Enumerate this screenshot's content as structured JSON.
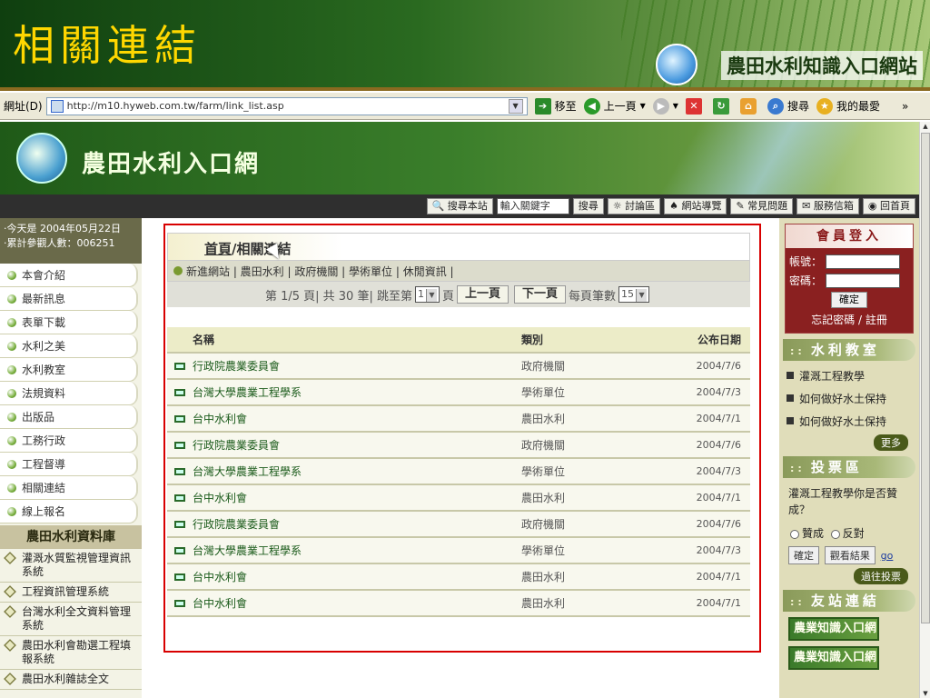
{
  "slide": {
    "title": "相關連結",
    "portal_name": "農田水利知識入口網站"
  },
  "browser": {
    "address_label": "網址(D)",
    "url": "http://m10.hyweb.com.tw/farm/link_list.asp",
    "go_label": "移至",
    "back_label": "上一頁",
    "search_label": "搜尋",
    "favorites_label": "我的最愛",
    "overflow": "»"
  },
  "site": {
    "name": "農田水利入口網"
  },
  "nav": {
    "search_site": "搜尋本站",
    "keyword_placeholder": "輸入關鍵字",
    "search_btn": "搜尋",
    "items": [
      "討論區",
      "網站導覽",
      "常見問題",
      "服務信箱",
      "回首頁"
    ]
  },
  "left": {
    "today": "·今天是 2004年05月22日",
    "visits": "·累計參觀人數：006251",
    "menu": [
      "本會介紹",
      "最新訊息",
      "表單下載",
      "水利之美",
      "水利教室",
      "法規資料",
      "出版品",
      "工務行政",
      "工程督導",
      "相關連結",
      "線上報名"
    ],
    "db_title": "農田水利資料庫",
    "db_items": [
      "灌溉水質監視管理資訊系統",
      "工程資訊管理系統",
      "台灣水利全文資料管理系統",
      "農田水利會勘選工程填報系統",
      "農田水利雜誌全文"
    ]
  },
  "main": {
    "crumb_home": "首頁",
    "crumb_sep": "/",
    "crumb_current": "相關連結",
    "categories": "新進網站 | 農田水利 | 政府機關 | 學術單位 | 休閒資訊 |",
    "pager": {
      "page_text": "第 1/5 頁| 共 30 筆| 跳至第",
      "page_value": "1",
      "page_unit": "頁",
      "prev": "上一頁",
      "next": "下一頁",
      "per_page_label": "每頁筆數",
      "per_page_value": "15"
    },
    "table": {
      "headers": [
        "名稱",
        "類別",
        "公布日期"
      ],
      "rows": [
        {
          "name": "行政院農業委員會",
          "cat": "政府機關",
          "date": "2004/7/6"
        },
        {
          "name": "台灣大學農業工程學系",
          "cat": "學術單位",
          "date": "2004/7/3"
        },
        {
          "name": "台中水利會",
          "cat": "農田水利",
          "date": "2004/7/1"
        },
        {
          "name": "行政院農業委員會",
          "cat": "政府機關",
          "date": "2004/7/6"
        },
        {
          "name": "台灣大學農業工程學系",
          "cat": "學術單位",
          "date": "2004/7/3"
        },
        {
          "name": "台中水利會",
          "cat": "農田水利",
          "date": "2004/7/1"
        },
        {
          "name": "行政院農業委員會",
          "cat": "政府機關",
          "date": "2004/7/6"
        },
        {
          "name": "台灣大學農業工程學系",
          "cat": "學術單位",
          "date": "2004/7/3"
        },
        {
          "name": "台中水利會",
          "cat": "農田水利",
          "date": "2004/7/1"
        },
        {
          "name": "台中水利會",
          "cat": "農田水利",
          "date": "2004/7/1"
        }
      ]
    }
  },
  "right": {
    "login": {
      "title": "會員登入",
      "account": "帳號：",
      "password": "密碼：",
      "submit": "確定",
      "forgot": "忘記密碼 / 註冊"
    },
    "classroom": {
      "title": "水利教室",
      "items": [
        "灌溉工程教學",
        "如何做好水土保持",
        "如何做好水土保持"
      ],
      "more": "更多"
    },
    "vote": {
      "title": "投票區",
      "question": "灌溉工程教學你是否贊成？",
      "opt1": "贊成",
      "opt2": "反對",
      "submit": "確定",
      "results": "觀看結果",
      "go": "go",
      "past": "過往投票"
    },
    "friends": {
      "title": "友站連結",
      "logo_text": "農業知識入口網"
    }
  },
  "colors": {
    "accent_red": "#d80000",
    "brand_green": "#2a6a20",
    "title_gold": "#ffd700"
  }
}
